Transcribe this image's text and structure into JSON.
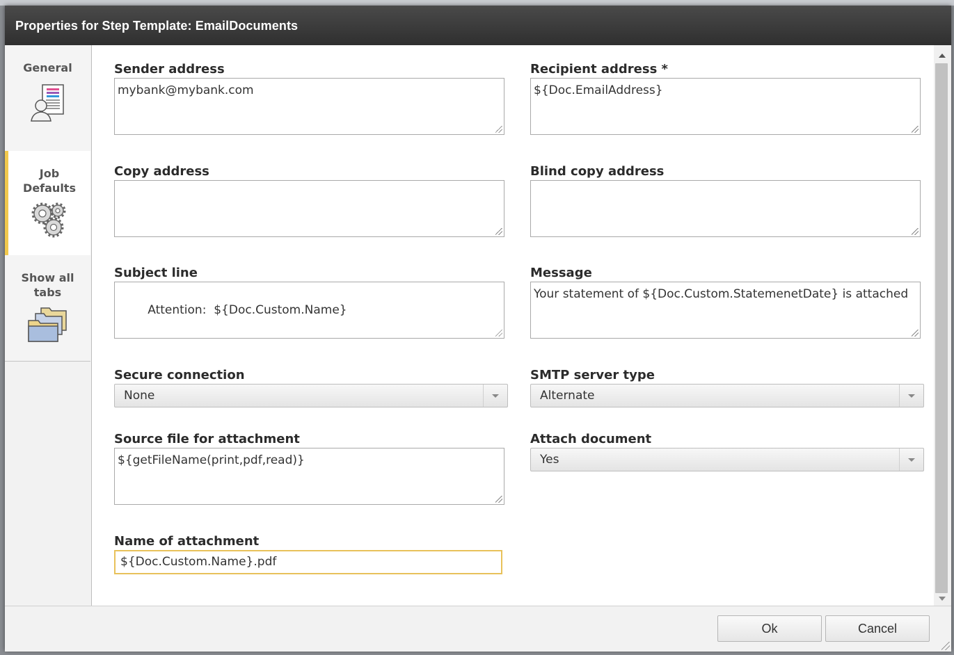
{
  "dialog": {
    "title": "Properties for Step Template: EmailDocuments"
  },
  "tabs": [
    {
      "label": "General",
      "icon": "document-user-icon"
    },
    {
      "label": "Job Defaults",
      "icon": "gears-icon",
      "active": true
    },
    {
      "label": "Show all tabs",
      "icon": "folders-icon"
    }
  ],
  "form": {
    "sender": {
      "label": "Sender address",
      "value": "mybank@mybank.com"
    },
    "recipient": {
      "label": "Recipient address *",
      "value": "${Doc.EmailAddress}"
    },
    "copy": {
      "label": "Copy address",
      "value": ""
    },
    "blind_copy": {
      "label": "Blind copy address",
      "value": ""
    },
    "subject": {
      "label": "Subject line",
      "value": "Attention:  ${Doc.Custom.Name}"
    },
    "message": {
      "label": "Message",
      "value": "Your statement of ${Doc.Custom.StatemenetDate} is attached"
    },
    "secure_connection": {
      "label": "Secure connection",
      "value": "None"
    },
    "smtp_server_type": {
      "label": "SMTP server type",
      "value": "Alternate"
    },
    "source_file": {
      "label": "Source file for attachment",
      "value": "${getFileName(print,pdf,read)}"
    },
    "attach_document": {
      "label": "Attach document",
      "value": "Yes"
    },
    "attachment_name": {
      "label": "Name of attachment",
      "value": "${Doc.Custom.Name}.pdf"
    }
  },
  "footer": {
    "ok_label": "Ok",
    "cancel_label": "Cancel"
  },
  "colors": {
    "titlebar": "#3a3a3a",
    "active_tab_accent": "#f2c94c",
    "focus_border": "#e8c15a"
  }
}
